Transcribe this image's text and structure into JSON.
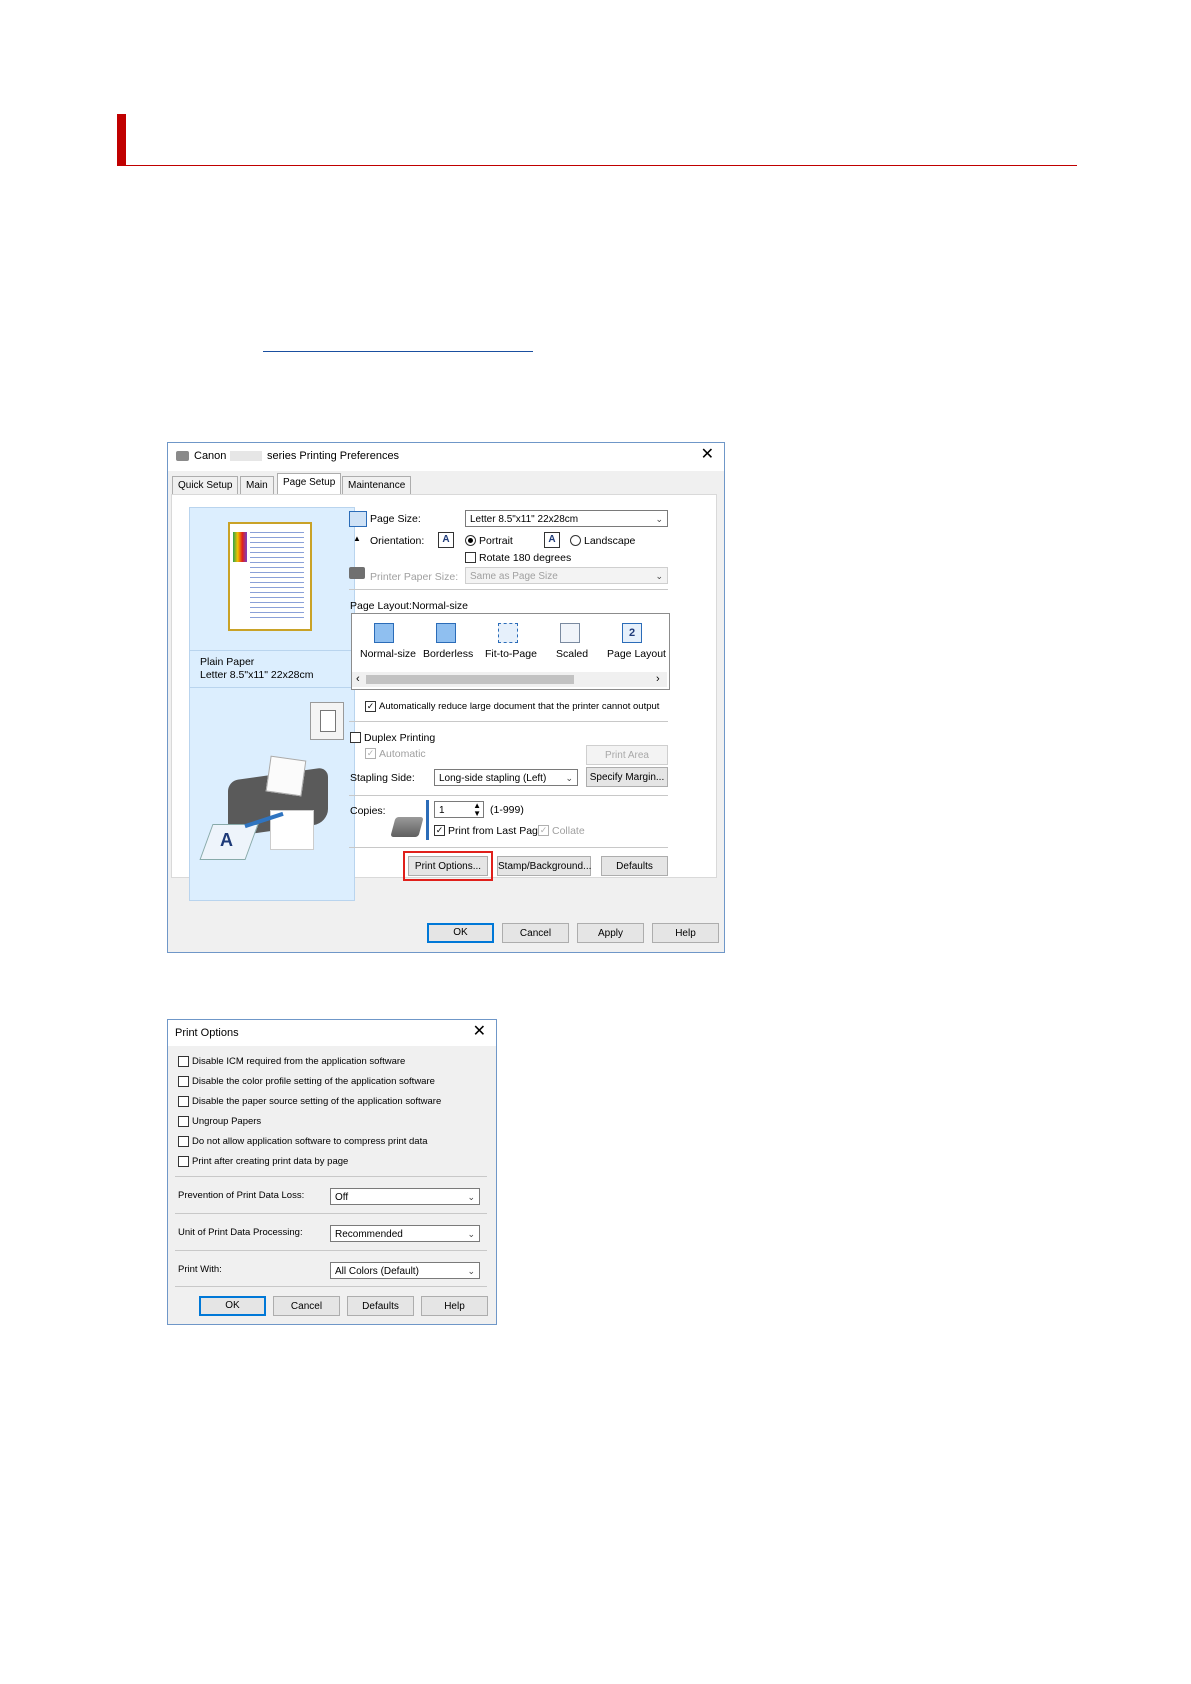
{
  "pref_window": {
    "title_prefix": "Canon",
    "title_suffix": "series Printing Preferences",
    "tabs": [
      "Quick Setup",
      "Main",
      "Page Setup",
      "Maintenance"
    ],
    "active_tab": "Page Setup",
    "media_info": {
      "line1": "Plain Paper",
      "line2": "Letter 8.5\"x11\" 22x28cm"
    },
    "page_size": {
      "label": "Page Size:",
      "value": "Letter 8.5\"x11\" 22x28cm"
    },
    "orientation": {
      "label": "Orientation:",
      "portrait": "Portrait",
      "landscape": "Landscape",
      "selected": "Portrait"
    },
    "rotate": {
      "label": "Rotate 180 degrees",
      "checked": false
    },
    "printer_paper_size": {
      "label": "Printer Paper Size:",
      "value": "Same as Page Size"
    },
    "page_layout": {
      "label": "Page Layout:",
      "value": "Normal-size",
      "options": [
        "Normal-size",
        "Borderless",
        "Fit-to-Page",
        "Scaled",
        "Page Layout"
      ]
    },
    "auto_reduce": {
      "label": "Automatically reduce large document that the printer cannot output",
      "checked": true
    },
    "duplex": {
      "label": "Duplex Printing",
      "checked": false
    },
    "automatic": {
      "label": "Automatic",
      "checked": true
    },
    "print_area_setup": "Print Area Setup...",
    "stapling": {
      "label": "Stapling Side:",
      "value": "Long-side stapling (Left)"
    },
    "specify_margin": "Specify Margin...",
    "copies": {
      "label": "Copies:",
      "value": "1",
      "range": "(1-999)"
    },
    "print_from_last": {
      "label": "Print from Last Page",
      "checked": true
    },
    "collate": {
      "label": "Collate",
      "checked": true
    },
    "buttons": {
      "print_options": "Print Options...",
      "stamp": "Stamp/Background...",
      "defaults": "Defaults",
      "ok": "OK",
      "cancel": "Cancel",
      "apply": "Apply",
      "help": "Help"
    }
  },
  "options_window": {
    "title": "Print Options",
    "checkboxes": [
      "Disable ICM required from the application software",
      "Disable the color profile setting of the application software",
      "Disable the paper source setting of the application software",
      "Ungroup Papers",
      "Do not allow application software to compress print data",
      "Print after creating print data by page"
    ],
    "prevention": {
      "label": "Prevention of Print Data Loss:",
      "value": "Off"
    },
    "unit": {
      "label": "Unit of Print Data Processing:",
      "value": "Recommended"
    },
    "print_with": {
      "label": "Print With:",
      "value": "All Colors (Default)"
    },
    "buttons": {
      "ok": "OK",
      "cancel": "Cancel",
      "defaults": "Defaults",
      "help": "Help"
    }
  },
  "icons": {
    "close": "close-icon",
    "chevron": "chevron-down-icon",
    "check": "checkmark-icon",
    "printer": "printer-icon"
  },
  "colors": {
    "heading_accent": "#c00000",
    "highlight": "#e0201b",
    "preview_bg": "#dceefe"
  }
}
